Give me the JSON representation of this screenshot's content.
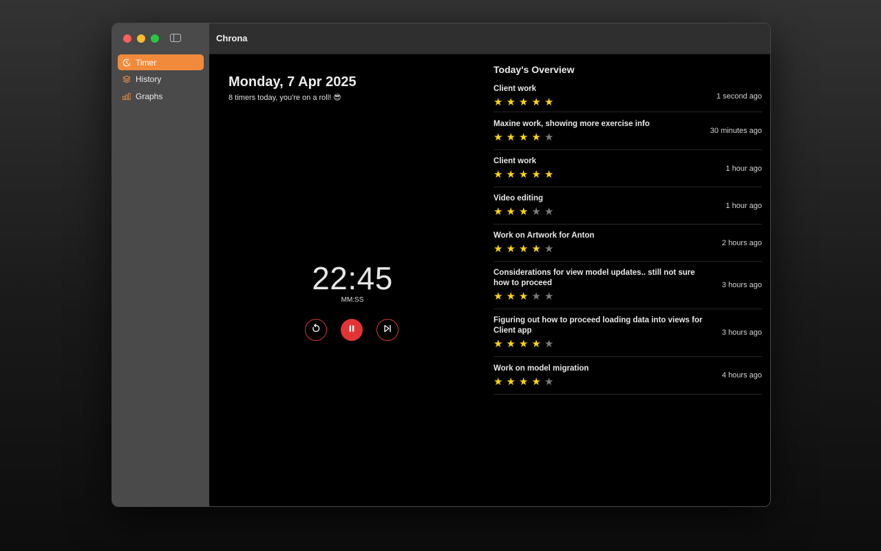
{
  "app": {
    "title": "Chrona"
  },
  "sidebar": {
    "items": [
      {
        "label": "Timer",
        "icon": "timer-icon",
        "active": true
      },
      {
        "label": "History",
        "icon": "stack-icon",
        "active": false
      },
      {
        "label": "Graphs",
        "icon": "bar-chart-icon",
        "active": false
      }
    ]
  },
  "main": {
    "date": "Monday, 7 Apr 2025",
    "subtitle": "8 timers today, you're on a roll! 😎",
    "timer": {
      "value": "22:45",
      "unit": "MM:SS"
    },
    "controls": {
      "restart_icon": "restart-icon",
      "pause_icon": "pause-icon",
      "skip_icon": "skip-forward-icon"
    }
  },
  "overview": {
    "title": "Today's Overview",
    "entries": [
      {
        "name": "Client work",
        "rating": 5,
        "time": "1 second ago"
      },
      {
        "name": "Maxine work, showing more exercise info",
        "rating": 4,
        "time": "30 minutes ago"
      },
      {
        "name": "Client work",
        "rating": 5,
        "time": "1 hour ago"
      },
      {
        "name": "Video editing",
        "rating": 3,
        "time": "1 hour ago"
      },
      {
        "name": "Work on Artwork for Anton",
        "rating": 4,
        "time": "2 hours ago"
      },
      {
        "name": "Considerations for view model updates.. still not sure how to proceed",
        "rating": 3,
        "time": "3 hours ago"
      },
      {
        "name": "Figuring out how to proceed loading data into views for Client app",
        "rating": 4,
        "time": "3 hours ago"
      },
      {
        "name": "Work on model migration",
        "rating": 4,
        "time": "4 hours ago"
      }
    ]
  },
  "colors": {
    "accent": "#f28a3c",
    "star_on": "#ffd60a",
    "star_off": "#7b7b7b",
    "control_red": "#e33434"
  }
}
